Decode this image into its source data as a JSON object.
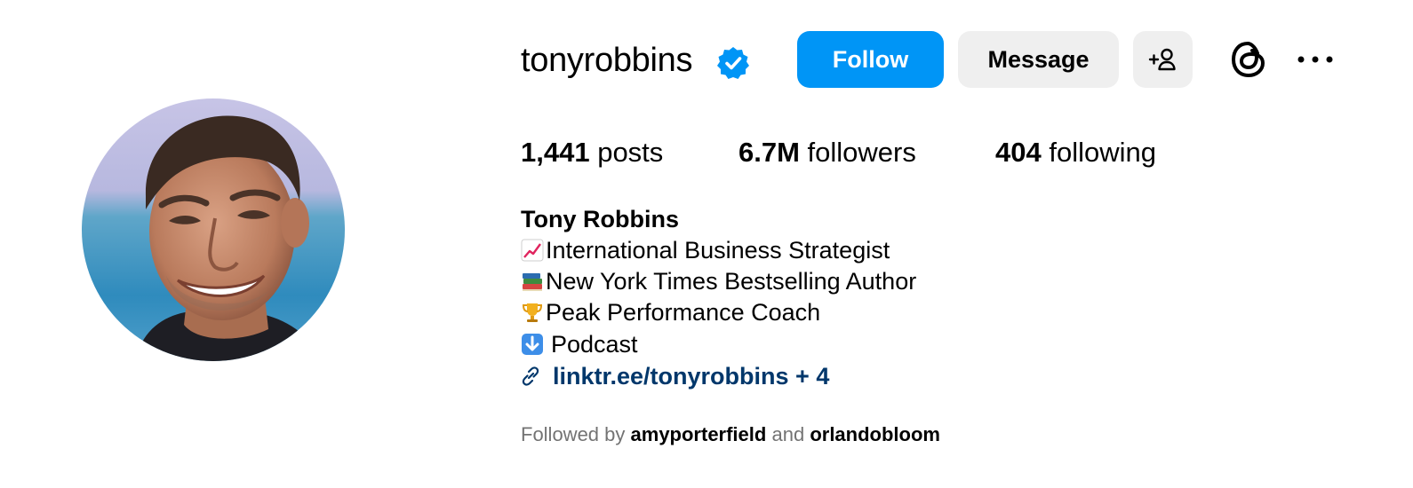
{
  "profile": {
    "username": "tonyrobbins",
    "verified": true,
    "full_name": "Tony Robbins"
  },
  "actions": {
    "follow_label": "Follow",
    "message_label": "Message",
    "suggest_icon": "add-person-icon",
    "threads_icon": "threads-icon",
    "more_icon": "more-options-icon"
  },
  "stats": {
    "posts_count": "1,441",
    "posts_label": "posts",
    "followers_count": "6.7M",
    "followers_label": "followers",
    "following_count": "404",
    "following_label": "following"
  },
  "bio": {
    "lines": [
      {
        "emoji": "chart-increasing-icon",
        "text": "International Business Strategist"
      },
      {
        "emoji": "books-icon",
        "text": "New York Times Bestselling Author"
      },
      {
        "emoji": "trophy-icon",
        "text": "Peak Performance Coach"
      },
      {
        "emoji": "down-arrow-icon",
        "text": "Podcast"
      }
    ],
    "link_text": "linktr.ee/tonyrobbins + 4"
  },
  "followed_by": {
    "prefix": "Followed by",
    "account_1": "amyporterfield",
    "conjunction": "and",
    "account_2": "orlandobloom"
  },
  "colors": {
    "follow_button": "#0095f6",
    "secondary_button": "#efefef",
    "link": "#00376b",
    "verified_badge": "#0095f6",
    "muted_text": "#737373"
  }
}
